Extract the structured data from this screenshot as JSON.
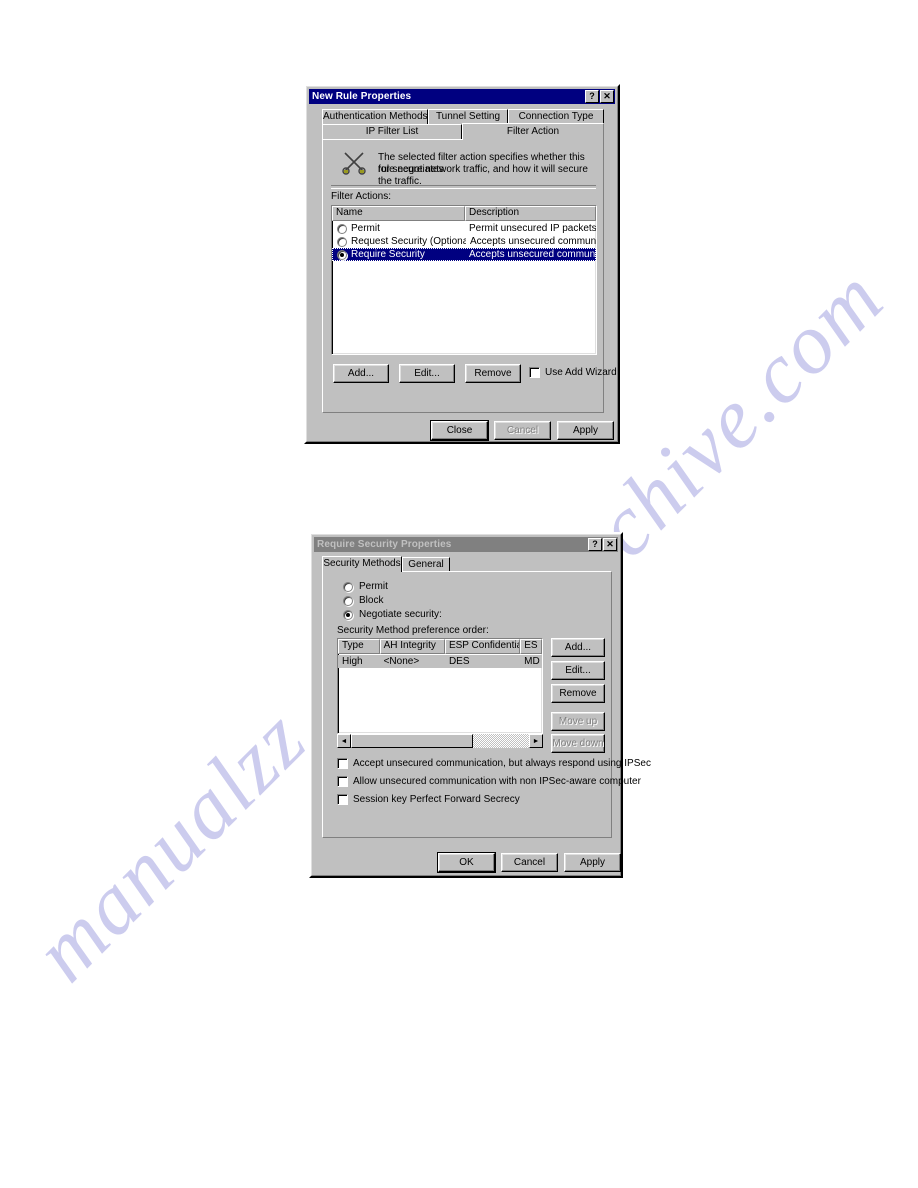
{
  "watermark": {
    "line1": "manualzz",
    "line2": "archive.com"
  },
  "dialog1": {
    "title": "New Rule Properties",
    "help_button": "?",
    "close_button": "✕",
    "tabs_row1": [
      {
        "label": "Authentication Methods",
        "selected": false
      },
      {
        "label": "Tunnel Setting",
        "selected": false
      },
      {
        "label": "Connection Type",
        "selected": false
      }
    ],
    "tabs_row2": [
      {
        "label": "IP Filter List",
        "selected": false
      },
      {
        "label": "Filter Action",
        "selected": true
      }
    ],
    "description_line1": "The selected filter action specifies whether this rule negotiates",
    "description_line2": "for secure network traffic, and how it will secure the traffic.",
    "icon_name": "crossed-keys-icon",
    "group_label": "Filter Actions:",
    "columns": [
      "Name",
      "Description"
    ],
    "rows": [
      {
        "selected": false,
        "checked": false,
        "name": "Permit",
        "description": "Permit unsecured IP packets to ..."
      },
      {
        "selected": false,
        "checked": false,
        "name": "Request Security (Optional)",
        "description": "Accepts unsecured communicat..."
      },
      {
        "selected": true,
        "checked": true,
        "name": "Require Security",
        "description": "Accepts unsecured communicat..."
      }
    ],
    "buttons": [
      {
        "label": "Add...",
        "disabled": false
      },
      {
        "label": "Edit...",
        "disabled": false
      },
      {
        "label": "Remove",
        "disabled": false
      }
    ],
    "wizard_checkbox": {
      "label": "Use Add Wizard",
      "checked": false
    },
    "footer_buttons": [
      {
        "label": "Close",
        "disabled": false,
        "default": true
      },
      {
        "label": "Cancel",
        "disabled": true,
        "default": false
      },
      {
        "label": "Apply",
        "disabled": false,
        "default": false
      }
    ]
  },
  "dialog2": {
    "title": "Require Security Properties",
    "help_button": "?",
    "close_button": "✕",
    "tabs": [
      {
        "label": "Security Methods",
        "selected": true
      },
      {
        "label": "General",
        "selected": false
      }
    ],
    "radios": [
      {
        "label": "Permit",
        "selected": false
      },
      {
        "label": "Block",
        "selected": false
      },
      {
        "label": "Negotiate security:",
        "selected": true
      }
    ],
    "group_label": "Security Method preference order:",
    "columns": [
      "Type",
      "AH Integrity",
      "ESP Confidential...",
      "ES"
    ],
    "rows": [
      {
        "selected": true,
        "cells": [
          "High",
          "<None>",
          "DES",
          "MD"
        ]
      }
    ],
    "side_buttons": [
      {
        "label": "Add...",
        "disabled": false
      },
      {
        "label": "Edit...",
        "disabled": false
      },
      {
        "label": "Remove",
        "disabled": false
      },
      {
        "label": "Move up",
        "disabled": true
      },
      {
        "label": "Move down",
        "disabled": true
      }
    ],
    "checkboxes": [
      {
        "label": "Accept unsecured communication, but always respond using IPSec",
        "checked": false
      },
      {
        "label": "Allow unsecured communication with non IPSec-aware computer",
        "checked": false
      },
      {
        "label": "Session key Perfect Forward Secrecy",
        "checked": false
      }
    ],
    "footer_buttons": [
      {
        "label": "OK",
        "disabled": false,
        "default": true
      },
      {
        "label": "Cancel",
        "disabled": false,
        "default": false
      },
      {
        "label": "Apply",
        "disabled": false,
        "default": false
      }
    ],
    "scrollbar": {
      "left_arrow": "◄",
      "right_arrow": "►"
    }
  }
}
